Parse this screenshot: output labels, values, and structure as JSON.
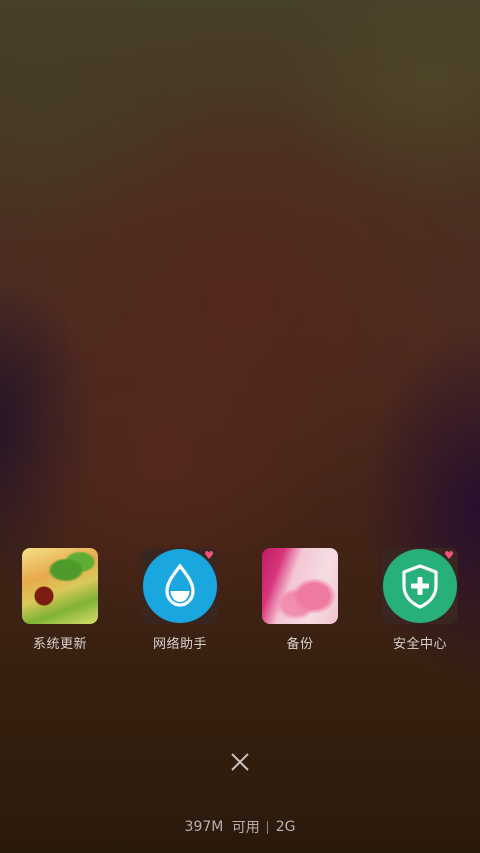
{
  "apps": [
    {
      "label": "系统更新",
      "icon": "system-update-thumbnail"
    },
    {
      "label": "网络助手",
      "icon": "water-drop-icon",
      "accent": "#1aa7e0"
    },
    {
      "label": "备份",
      "icon": "backup-flower-thumbnail"
    },
    {
      "label": "安全中心",
      "icon": "shield-plus-icon",
      "accent": "#27b079"
    }
  ],
  "close_icon": "close-icon",
  "status": {
    "memory": "397M",
    "available_label": "可用",
    "network": "2G"
  }
}
